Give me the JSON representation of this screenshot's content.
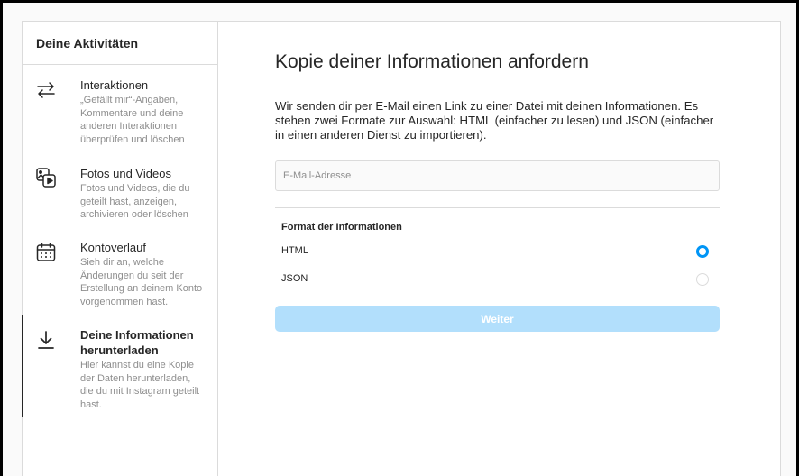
{
  "sidebar": {
    "title": "Deine Aktivitäten",
    "items": [
      {
        "icon": "arrows-exchange-icon",
        "label": "Interaktionen",
        "description": "„Gefällt mir“-Angaben, Kommentare und deine anderen Interaktionen überprüfen und löschen"
      },
      {
        "icon": "photo-video-icon",
        "label": "Fotos und Videos",
        "description": "Fotos und Videos, die du geteilt hast, anzeigen, archivieren oder löschen"
      },
      {
        "icon": "calendar-icon",
        "label": "Kontoverlauf",
        "description": "Sieh dir an, welche Änderungen du seit der Erstellung an deinem Konto vorgenommen hast."
      },
      {
        "icon": "download-icon",
        "label": "Deine Informationen herunterladen",
        "description": "Hier kannst du eine Kopie der Daten herunterladen, die du mit Instagram geteilt hast.",
        "active": true
      }
    ]
  },
  "main": {
    "title": "Kopie deiner Informationen anfordern",
    "intro": "Wir senden dir per E-Mail einen Link zu einer Datei mit deinen Informationen. Es stehen zwei Formate zur Auswahl: HTML (einfacher zu lesen) und JSON (einfacher in einen anderen Dienst zu importieren).",
    "email": {
      "placeholder": "E-Mail-Adresse",
      "value": ""
    },
    "format_heading": "Format der Informationen",
    "formats": [
      {
        "label": "HTML",
        "selected": true
      },
      {
        "label": "JSON",
        "selected": false
      }
    ],
    "submit_label": "Weiter"
  },
  "colors": {
    "accent": "#0095f6",
    "button_disabled": "#b2dffc",
    "border": "#dbdbdb",
    "text": "#262626",
    "muted": "#8e8e8e"
  }
}
